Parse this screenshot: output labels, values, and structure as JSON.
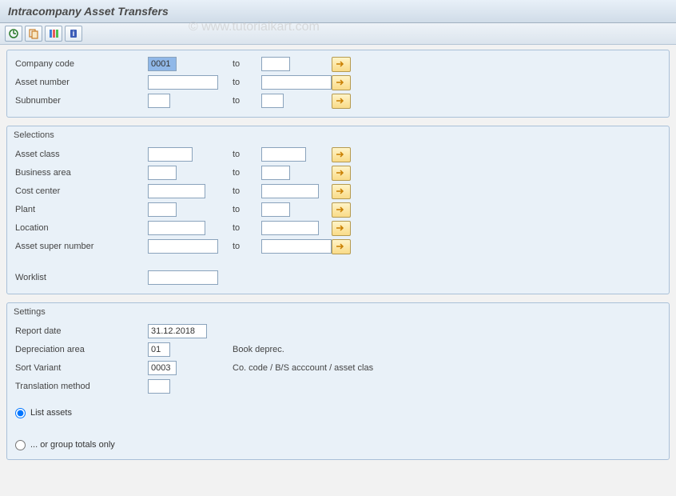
{
  "title": "Intracompany Asset Transfers",
  "toolbar": {
    "execute": "Execute",
    "get_variant": "Get Variant",
    "all_selections": "All Selections",
    "program_doc": "Program Documentation"
  },
  "group1": {
    "company_code": {
      "label": "Company code",
      "from": "0001",
      "to": ""
    },
    "asset_number": {
      "label": "Asset number",
      "from": "",
      "to": ""
    },
    "subnumber": {
      "label": "Subnumber",
      "from": "",
      "to": ""
    }
  },
  "group2": {
    "title": "Selections",
    "asset_class": {
      "label": "Asset class",
      "from": "",
      "to": ""
    },
    "business_area": {
      "label": "Business area",
      "from": "",
      "to": ""
    },
    "cost_center": {
      "label": "Cost center",
      "from": "",
      "to": ""
    },
    "plant": {
      "label": "Plant",
      "from": "",
      "to": ""
    },
    "location": {
      "label": "Location",
      "from": "",
      "to": ""
    },
    "asset_super": {
      "label": "Asset super number",
      "from": "",
      "to": ""
    },
    "worklist": {
      "label": "Worklist",
      "value": ""
    }
  },
  "group3": {
    "title": "Settings",
    "report_date": {
      "label": "Report date",
      "value": "31.12.2018"
    },
    "depr_area": {
      "label": "Depreciation area",
      "value": "01",
      "desc": "Book deprec."
    },
    "sort_variant": {
      "label": "Sort Variant",
      "value": "0003",
      "desc": "Co. code / B/S acccount / asset clas"
    },
    "transl_method": {
      "label": "Translation method",
      "value": ""
    },
    "radio_list": "List assets",
    "radio_group": "... or group totals only"
  },
  "labels": {
    "to": "to"
  },
  "watermark": "© www.tutorialkart.com"
}
